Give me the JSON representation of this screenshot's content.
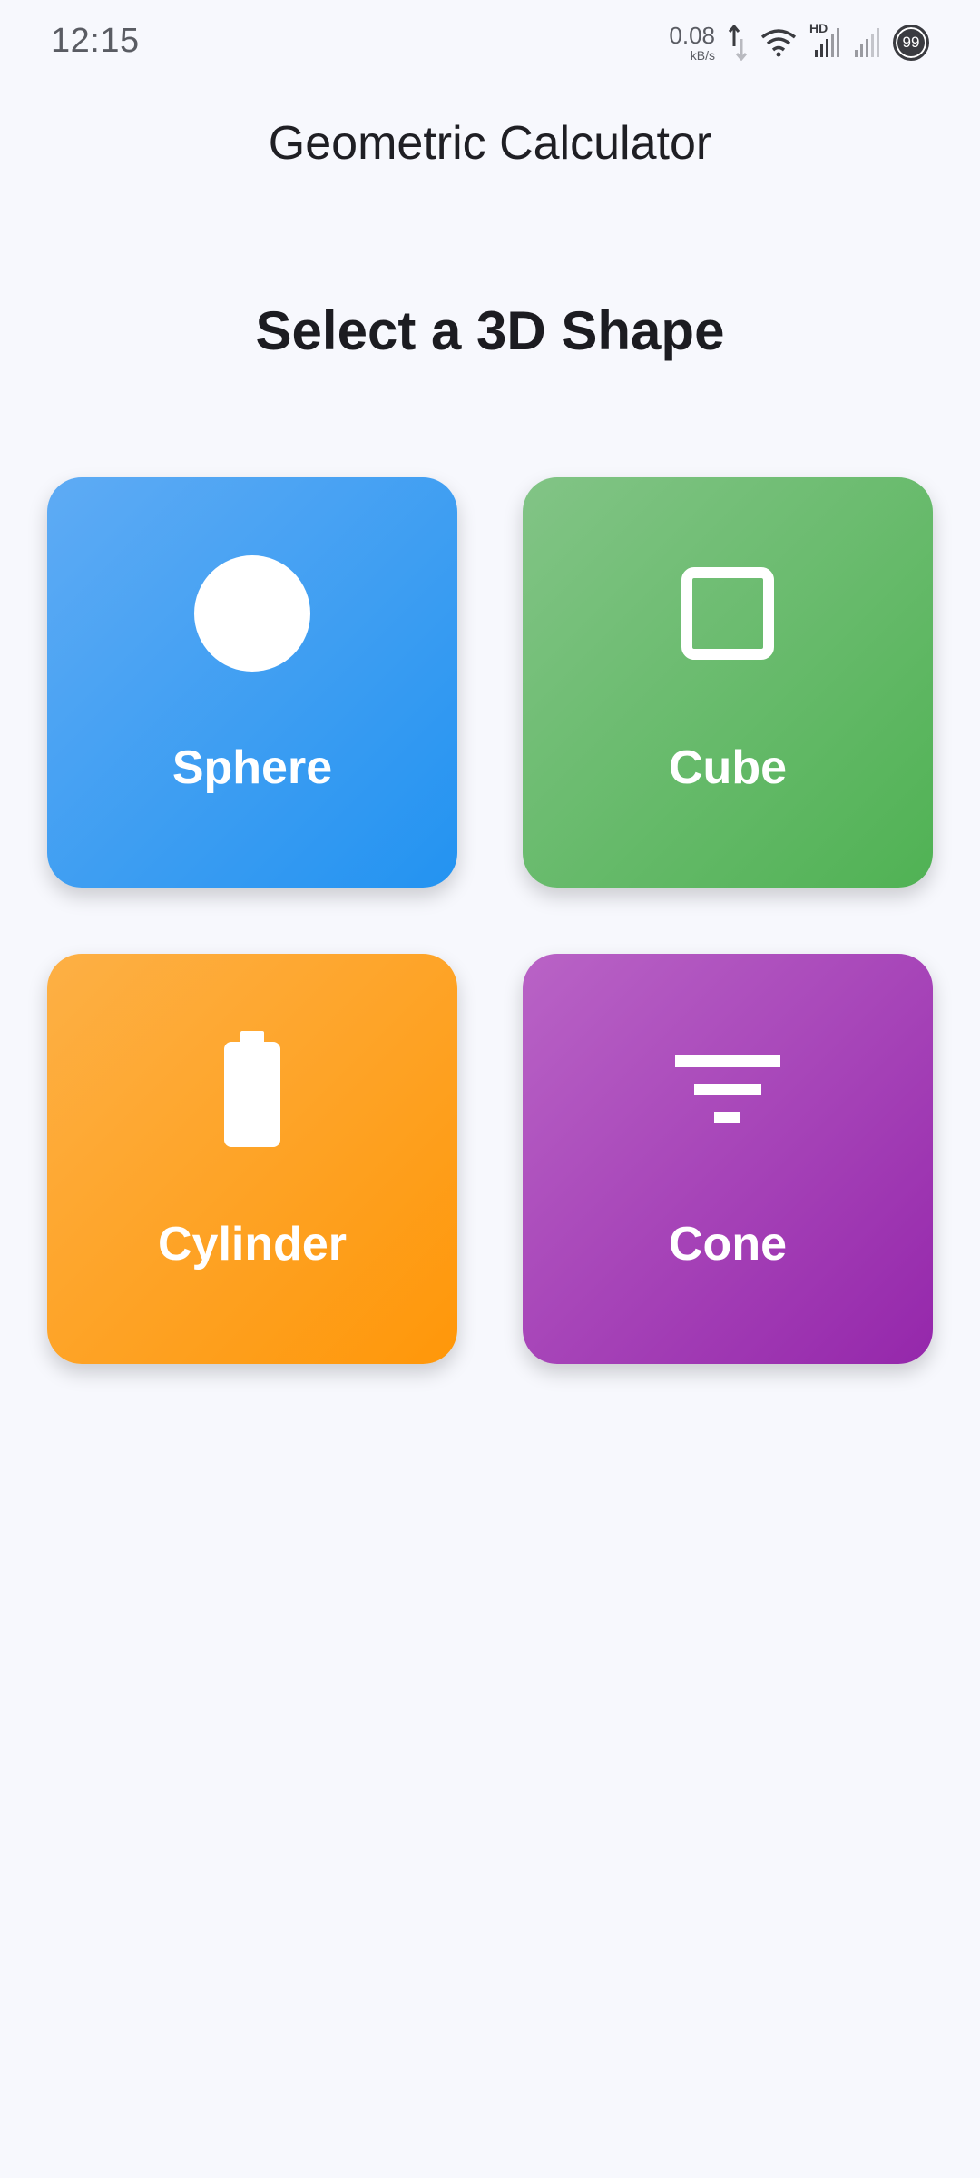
{
  "status_bar": {
    "time": "12:15",
    "net_speed_value": "0.08",
    "net_speed_unit": "kB/s",
    "network_label": "HD",
    "battery_level": "99",
    "icons": [
      "data-activity-icon",
      "wifi-icon",
      "signal-hd-icon",
      "signal-icon",
      "battery-icon"
    ]
  },
  "app": {
    "title": "Geometric Calculator"
  },
  "main": {
    "heading": "Select a 3D Shape",
    "shapes": [
      {
        "label": "Sphere",
        "icon": "circle-icon",
        "color_start": "#5eabf4",
        "color_end": "#2393f1"
      },
      {
        "label": "Cube",
        "icon": "square-outline-icon",
        "color_start": "#82c486",
        "color_end": "#50b254"
      },
      {
        "label": "Cylinder",
        "icon": "battery-shape-icon",
        "color_start": "#fdb045",
        "color_end": "#ff9709"
      },
      {
        "label": "Cone",
        "icon": "filter-icon",
        "color_start": "#b963c6",
        "color_end": "#9527ab"
      }
    ]
  },
  "colors": {
    "background": "#f7f8fd",
    "text_primary": "#1c1c21",
    "icon_white": "#ffffff"
  }
}
